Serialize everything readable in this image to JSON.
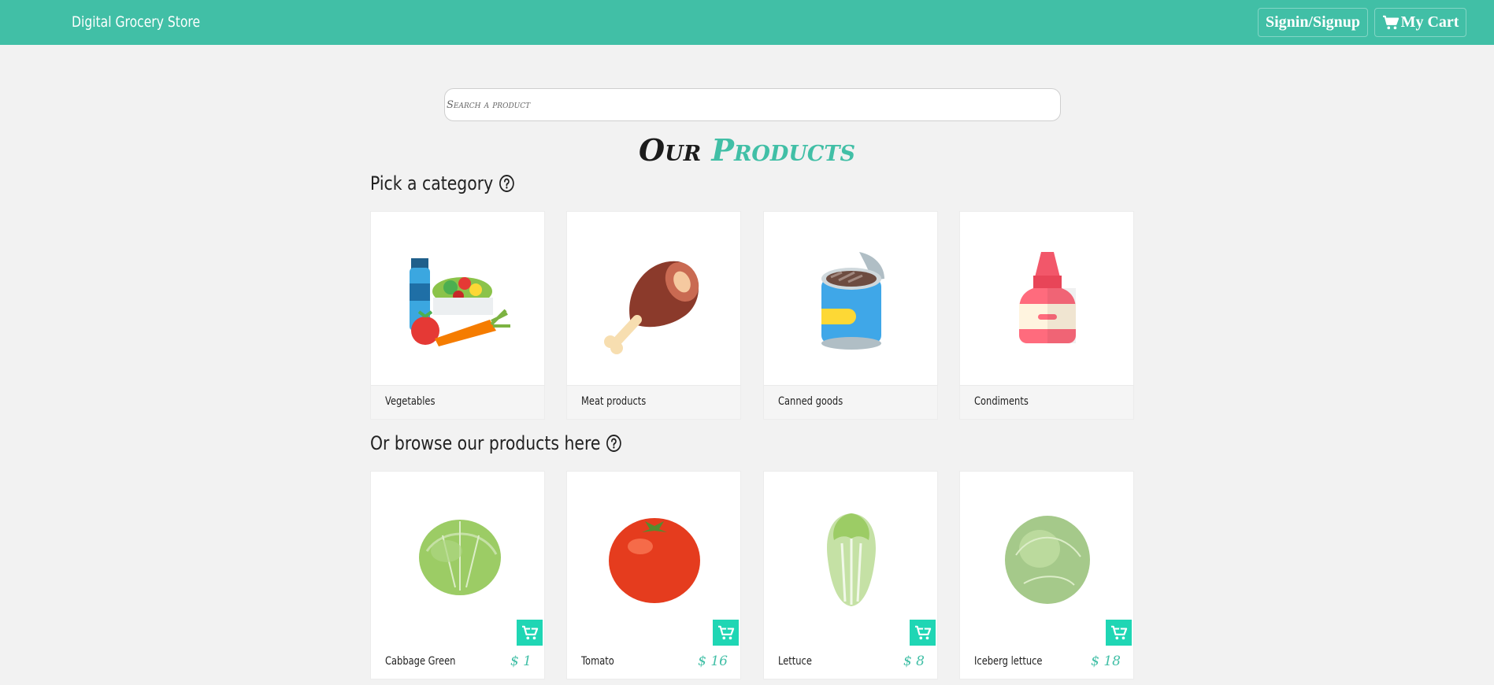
{
  "navbar": {
    "brand": "Digital Grocery Store",
    "signin_label": "Signin/Signup",
    "cart_label": "My Cart"
  },
  "search": {
    "placeholder": "Search a product",
    "value": ""
  },
  "heading": {
    "part1": "Our",
    "part2": "Products"
  },
  "categories": {
    "title": "Pick a category",
    "items": [
      {
        "label": "Vegetables",
        "icon": "vegetables-icon"
      },
      {
        "label": "Meat products",
        "icon": "meat-icon"
      },
      {
        "label": "Canned goods",
        "icon": "canned-goods-icon"
      },
      {
        "label": "Condiments",
        "icon": "condiments-icon"
      }
    ]
  },
  "products": {
    "title": "Or browse our products here",
    "items": [
      {
        "name": "Cabbage Green",
        "price": "$ 1"
      },
      {
        "name": "Tomato",
        "price": "$ 16"
      },
      {
        "name": "Lettuce",
        "price": "$ 8"
      },
      {
        "name": "Iceberg lettuce",
        "price": "$ 18"
      }
    ]
  },
  "colors": {
    "accent": "#41bfa6",
    "add_button": "#1fd6b4",
    "background": "#f2f2f2"
  }
}
